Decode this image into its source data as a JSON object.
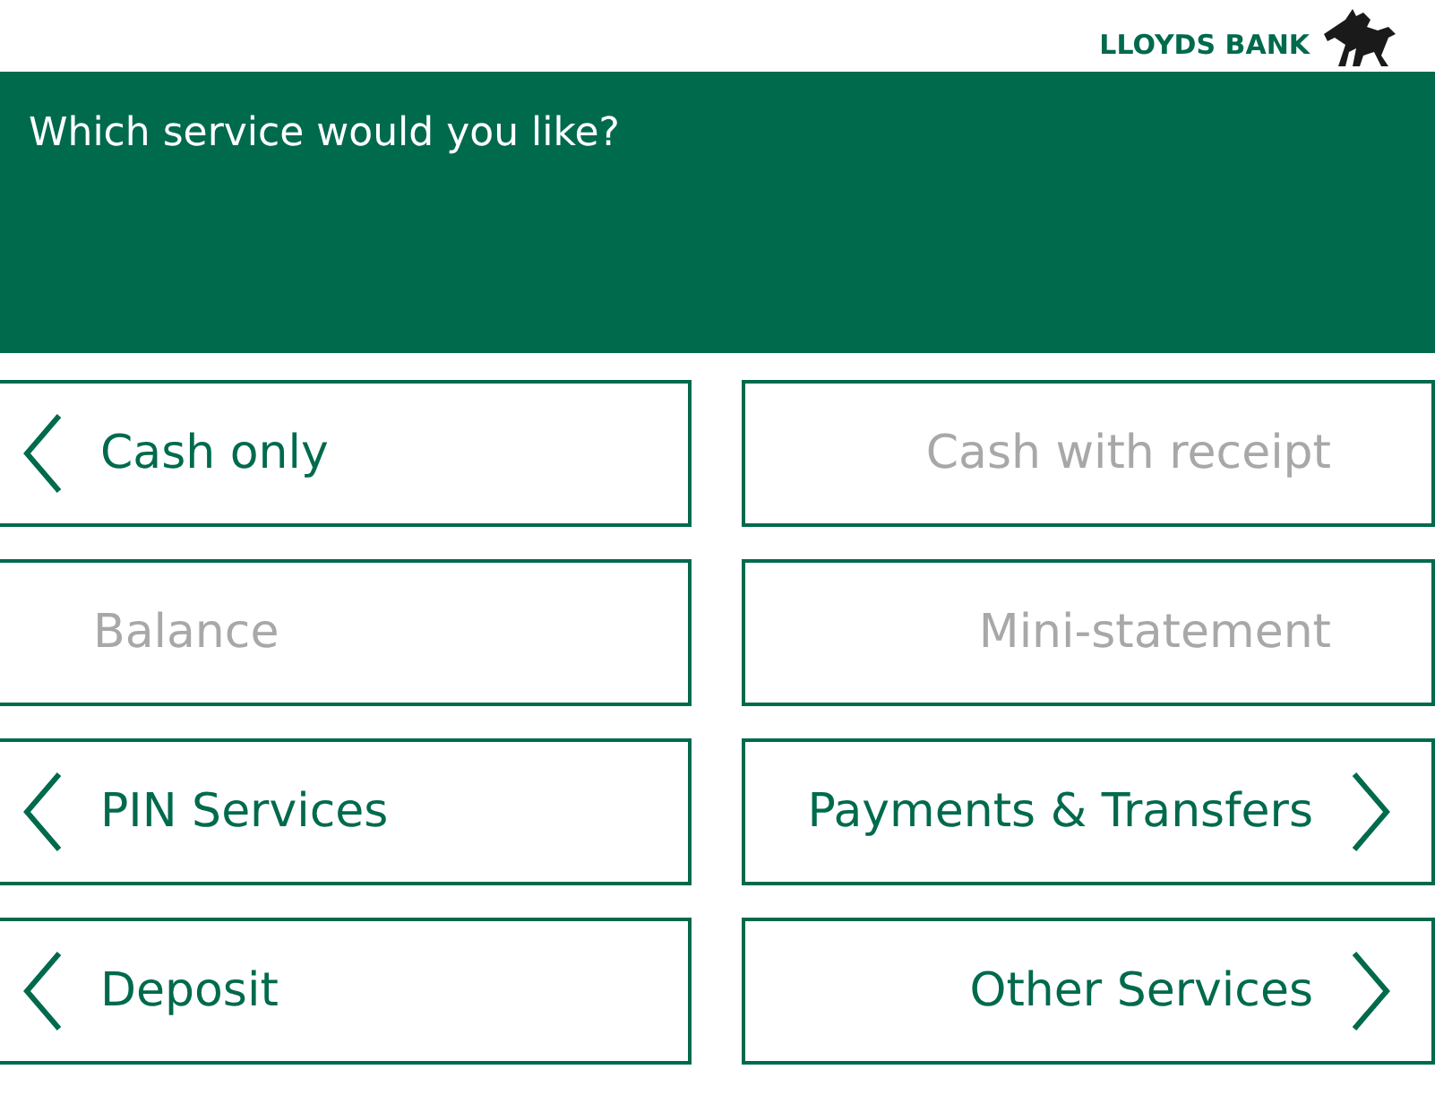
{
  "brand": {
    "name": "LLOYDS BANK"
  },
  "header": {
    "title": "Which service would you like?"
  },
  "options": [
    {
      "label": "Cash only",
      "disabled": false
    },
    {
      "label": "Cash with receipt",
      "disabled": true
    },
    {
      "label": "Balance",
      "disabled": true
    },
    {
      "label": "Mini-statement",
      "disabled": true
    },
    {
      "label": "PIN Services",
      "disabled": false
    },
    {
      "label": "Payments & Transfers",
      "disabled": false
    },
    {
      "label": "Deposit",
      "disabled": false
    },
    {
      "label": "Other Services",
      "disabled": false
    }
  ]
}
